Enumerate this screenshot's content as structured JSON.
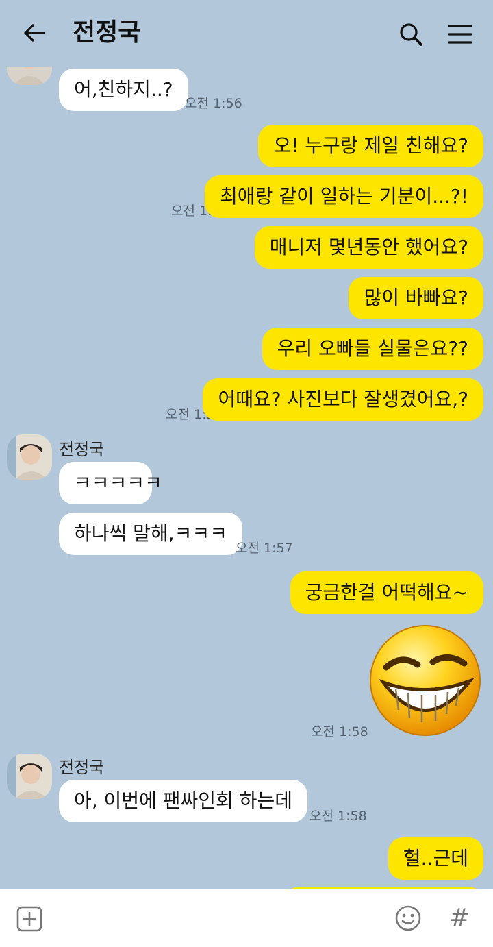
{
  "header": {
    "title": "전정국"
  },
  "messages": {
    "m1": "어,친하지..?",
    "m1_time": "오전 1:56",
    "m2": "오! 누구랑 제일 친해요?",
    "m3": "최애랑 같이 일하는 기분이...?!",
    "m3_time": "오전 1:56",
    "m4": "매니저 몇년동안 했어요?",
    "m5": "많이 바빠요?",
    "m6": "우리 오빠들 실물은요??",
    "m7": "어때요? 사진보다 잘생겼어요,?",
    "m7_time": "오전 1:57",
    "sender1": "전정국",
    "m8": "ㅋㅋㅋㅋㅋ",
    "m9": "하나씩 말해,ㅋㅋㅋ",
    "m9_time": "오전 1:57",
    "m10": "궁금한걸 어떡해요~",
    "emoji_time": "오전 1:58",
    "sender2": "전정국",
    "m11": "아, 이번에 팬싸인회 하는데",
    "m11_time": "오전 1:58",
    "m12": "헐..근데"
  },
  "icons": {
    "back": "arrow-left-icon",
    "search": "search-icon",
    "menu": "hamburger-menu-icon",
    "attach": "plus-box-icon",
    "emoticon": "smile-icon",
    "hashtag": "hash-icon"
  },
  "input": {
    "hashtag_glyph": "#"
  },
  "colors": {
    "background": "#b2c7da",
    "my_bubble": "#fee500",
    "other_bubble": "#ffffff"
  }
}
